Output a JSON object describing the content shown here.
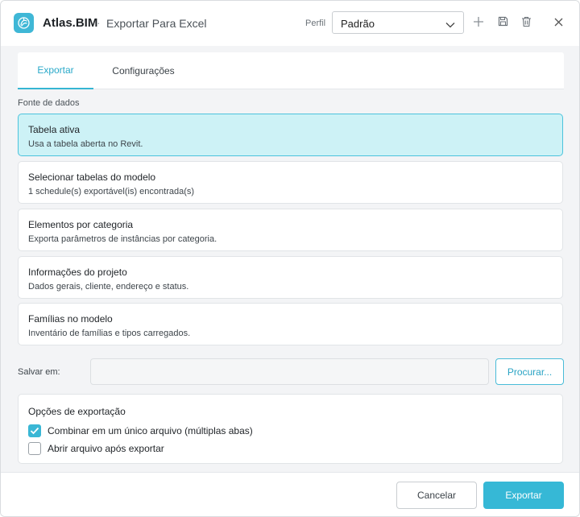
{
  "header": {
    "app_name": "Atlas.BIM",
    "separator": "·",
    "title": "Exportar Para Excel",
    "profile_label": "Perfil",
    "profile_value": "Padrão",
    "icons": [
      "app-logo-icon",
      "chevron-down-icon",
      "plus-icon",
      "save-icon",
      "trash-icon",
      "close-icon"
    ]
  },
  "tabs": [
    {
      "label": "Exportar",
      "active": true
    },
    {
      "label": "Configurações",
      "active": false
    }
  ],
  "data_source": {
    "label": "Fonte de dados",
    "options": [
      {
        "title": "Tabela ativa",
        "description": "Usa a tabela aberta no Revit.",
        "selected": true
      },
      {
        "title": "Selecionar tabelas do modelo",
        "description": "1 schedule(s) exportável(is) encontrada(s)",
        "selected": false
      },
      {
        "title": "Elementos por categoria",
        "description": "Exporta parâmetros de instâncias por categoria.",
        "selected": false
      },
      {
        "title": "Informações do projeto",
        "description": "Dados gerais, cliente, endereço e status.",
        "selected": false
      },
      {
        "title": "Famílias no modelo",
        "description": "Inventário de famílias e tipos carregados.",
        "selected": false
      }
    ]
  },
  "save": {
    "label": "Salvar em:",
    "value": "",
    "browse_label": "Procurar..."
  },
  "options": {
    "title": "Opções de exportação",
    "items": [
      {
        "label": "Combinar em um único arquivo (múltiplas abas)",
        "checked": true
      },
      {
        "label": "Abrir arquivo após exportar",
        "checked": false
      }
    ]
  },
  "footer": {
    "cancel_label": "Cancelar",
    "export_label": "Exportar"
  },
  "colors": {
    "accent": "#36b8d6",
    "selected_card_bg": "#cdf2f6",
    "selected_card_border": "#4cc3dc"
  }
}
